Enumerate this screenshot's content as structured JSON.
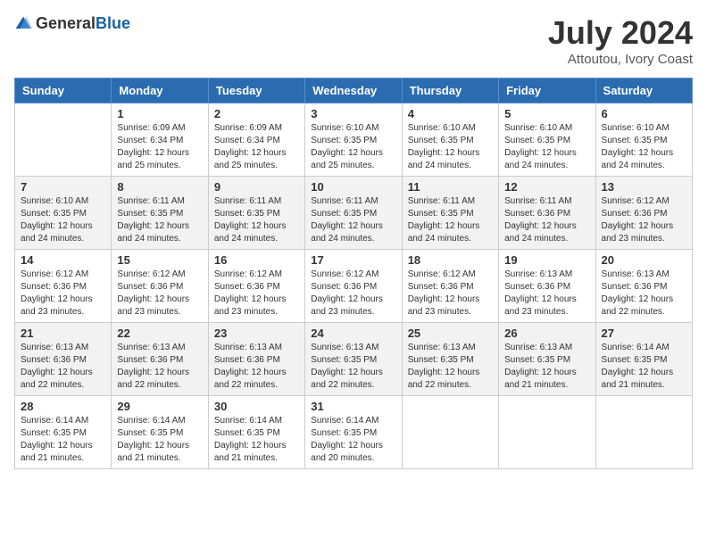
{
  "header": {
    "logo_general": "General",
    "logo_blue": "Blue",
    "month_year": "July 2024",
    "location": "Attoutou, Ivory Coast"
  },
  "days_of_week": [
    "Sunday",
    "Monday",
    "Tuesday",
    "Wednesday",
    "Thursday",
    "Friday",
    "Saturday"
  ],
  "weeks": [
    [
      {
        "day": "",
        "info": ""
      },
      {
        "day": "1",
        "info": "Sunrise: 6:09 AM\nSunset: 6:34 PM\nDaylight: 12 hours\nand 25 minutes."
      },
      {
        "day": "2",
        "info": "Sunrise: 6:09 AM\nSunset: 6:34 PM\nDaylight: 12 hours\nand 25 minutes."
      },
      {
        "day": "3",
        "info": "Sunrise: 6:10 AM\nSunset: 6:35 PM\nDaylight: 12 hours\nand 25 minutes."
      },
      {
        "day": "4",
        "info": "Sunrise: 6:10 AM\nSunset: 6:35 PM\nDaylight: 12 hours\nand 24 minutes."
      },
      {
        "day": "5",
        "info": "Sunrise: 6:10 AM\nSunset: 6:35 PM\nDaylight: 12 hours\nand 24 minutes."
      },
      {
        "day": "6",
        "info": "Sunrise: 6:10 AM\nSunset: 6:35 PM\nDaylight: 12 hours\nand 24 minutes."
      }
    ],
    [
      {
        "day": "7",
        "info": ""
      },
      {
        "day": "8",
        "info": "Sunrise: 6:11 AM\nSunset: 6:35 PM\nDaylight: 12 hours\nand 24 minutes."
      },
      {
        "day": "9",
        "info": "Sunrise: 6:11 AM\nSunset: 6:35 PM\nDaylight: 12 hours\nand 24 minutes."
      },
      {
        "day": "10",
        "info": "Sunrise: 6:11 AM\nSunset: 6:35 PM\nDaylight: 12 hours\nand 24 minutes."
      },
      {
        "day": "11",
        "info": "Sunrise: 6:11 AM\nSunset: 6:35 PM\nDaylight: 12 hours\nand 24 minutes."
      },
      {
        "day": "12",
        "info": "Sunrise: 6:11 AM\nSunset: 6:36 PM\nDaylight: 12 hours\nand 24 minutes."
      },
      {
        "day": "13",
        "info": "Sunrise: 6:12 AM\nSunset: 6:36 PM\nDaylight: 12 hours\nand 23 minutes."
      }
    ],
    [
      {
        "day": "14",
        "info": ""
      },
      {
        "day": "15",
        "info": "Sunrise: 6:12 AM\nSunset: 6:36 PM\nDaylight: 12 hours\nand 23 minutes."
      },
      {
        "day": "16",
        "info": "Sunrise: 6:12 AM\nSunset: 6:36 PM\nDaylight: 12 hours\nand 23 minutes."
      },
      {
        "day": "17",
        "info": "Sunrise: 6:12 AM\nSunset: 6:36 PM\nDaylight: 12 hours\nand 23 minutes."
      },
      {
        "day": "18",
        "info": "Sunrise: 6:12 AM\nSunset: 6:36 PM\nDaylight: 12 hours\nand 23 minutes."
      },
      {
        "day": "19",
        "info": "Sunrise: 6:13 AM\nSunset: 6:36 PM\nDaylight: 12 hours\nand 23 minutes."
      },
      {
        "day": "20",
        "info": "Sunrise: 6:13 AM\nSunset: 6:36 PM\nDaylight: 12 hours\nand 22 minutes."
      }
    ],
    [
      {
        "day": "21",
        "info": ""
      },
      {
        "day": "22",
        "info": "Sunrise: 6:13 AM\nSunset: 6:36 PM\nDaylight: 12 hours\nand 22 minutes."
      },
      {
        "day": "23",
        "info": "Sunrise: 6:13 AM\nSunset: 6:36 PM\nDaylight: 12 hours\nand 22 minutes."
      },
      {
        "day": "24",
        "info": "Sunrise: 6:13 AM\nSunset: 6:35 PM\nDaylight: 12 hours\nand 22 minutes."
      },
      {
        "day": "25",
        "info": "Sunrise: 6:13 AM\nSunset: 6:35 PM\nDaylight: 12 hours\nand 22 minutes."
      },
      {
        "day": "26",
        "info": "Sunrise: 6:13 AM\nSunset: 6:35 PM\nDaylight: 12 hours\nand 21 minutes."
      },
      {
        "day": "27",
        "info": "Sunrise: 6:14 AM\nSunset: 6:35 PM\nDaylight: 12 hours\nand 21 minutes."
      }
    ],
    [
      {
        "day": "28",
        "info": "Sunrise: 6:14 AM\nSunset: 6:35 PM\nDaylight: 12 hours\nand 21 minutes."
      },
      {
        "day": "29",
        "info": "Sunrise: 6:14 AM\nSunset: 6:35 PM\nDaylight: 12 hours\nand 21 minutes."
      },
      {
        "day": "30",
        "info": "Sunrise: 6:14 AM\nSunset: 6:35 PM\nDaylight: 12 hours\nand 21 minutes."
      },
      {
        "day": "31",
        "info": "Sunrise: 6:14 AM\nSunset: 6:35 PM\nDaylight: 12 hours\nand 20 minutes."
      },
      {
        "day": "",
        "info": ""
      },
      {
        "day": "",
        "info": ""
      },
      {
        "day": "",
        "info": ""
      }
    ]
  ],
  "week7_day7_info": "Sunrise: 6:10 AM\nSunset: 6:35 PM\nDaylight: 12 hours\nand 24 minutes.",
  "week14_day14_info": "Sunrise: 6:12 AM\nSunset: 6:36 PM\nDaylight: 12 hours\nand 23 minutes.",
  "week21_day21_info": "Sunrise: 6:13 AM\nSunset: 6:36 PM\nDaylight: 12 hours\nand 22 minutes."
}
